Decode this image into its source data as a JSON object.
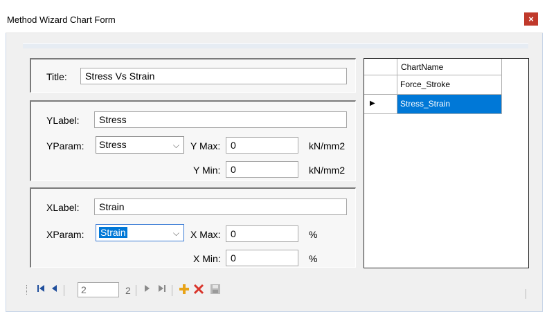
{
  "window": {
    "title": "Method Wizard Chart Form",
    "close_glyph": "×"
  },
  "title_group": {
    "label": "Title:",
    "value": "Stress Vs Strain"
  },
  "y_group": {
    "label_label": "YLabel:",
    "label_value": "Stress",
    "param_label": "YParam:",
    "param_value": "Stress",
    "max_label": "Y Max:",
    "max_value": "0",
    "max_unit": "kN/mm2",
    "min_label": "Y Min:",
    "min_value": "0",
    "min_unit": "kN/mm2"
  },
  "x_group": {
    "label_label": "XLabel:",
    "label_value": "Strain",
    "param_label": "XParam:",
    "param_value": "Strain",
    "max_label": "X Max:",
    "max_value": "0",
    "max_unit": "%",
    "min_label": "X Min:",
    "min_value": "0",
    "min_unit": "%"
  },
  "grid": {
    "column_header": "ChartName",
    "rows": [
      "Force_Stroke",
      "Stress_Strain"
    ],
    "current_row_glyph": "▶"
  },
  "navigator": {
    "position": "2",
    "count_text": "2",
    "icons": [
      "move-first-icon",
      "move-previous-icon",
      "move-next-icon",
      "move-last-icon",
      "add-new-icon",
      "delete-icon",
      "save-icon"
    ]
  },
  "colors": {
    "selection": "#0078d7",
    "close_button": "#c0392b",
    "add": "#e8a317",
    "delete": "#d9342b"
  }
}
